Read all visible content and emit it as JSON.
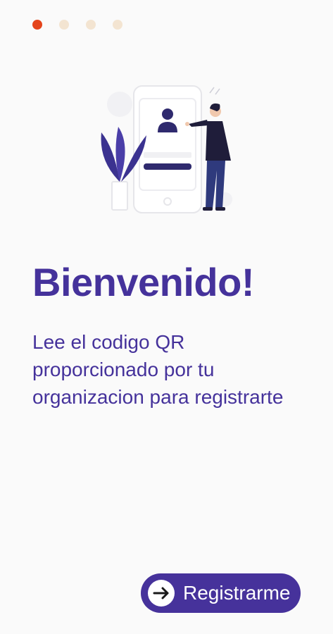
{
  "pagination": {
    "total": 4,
    "active_index": 0
  },
  "welcome": {
    "title": "Bienvenido!",
    "subtitle": "Lee el codigo QR proporcionado por tu organizacion para registrarte"
  },
  "actions": {
    "register_label": "Registrarme",
    "register_icon": "arrow-right-circle-icon"
  },
  "colors": {
    "primary": "#46329b",
    "accent": "#e4441b",
    "dot_inactive": "#f3e4d1",
    "background": "#fafafa"
  }
}
